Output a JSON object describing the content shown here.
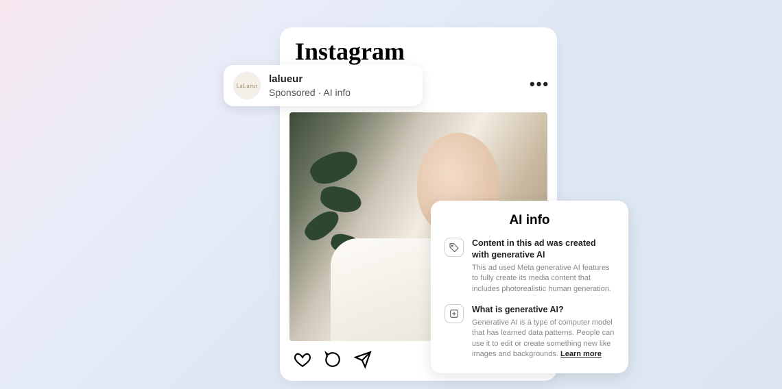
{
  "brand": "Instagram",
  "profile": {
    "avatar_text": "LaLueur",
    "username": "lalueur",
    "subtitle": "Sponsored · AI info"
  },
  "info_panel": {
    "title": "AI info",
    "sections": [
      {
        "heading": "Content in this ad was created with generative AI",
        "body": "This ad used Meta generative AI features to fully create its media content that includes photorealistic human generation."
      },
      {
        "heading": "What is generative AI?",
        "body": "Generative AI is a type of computer model that has learned data patterns. People can use it to edit or create something new like images and backgrounds. ",
        "link": "Learn more"
      }
    ]
  }
}
